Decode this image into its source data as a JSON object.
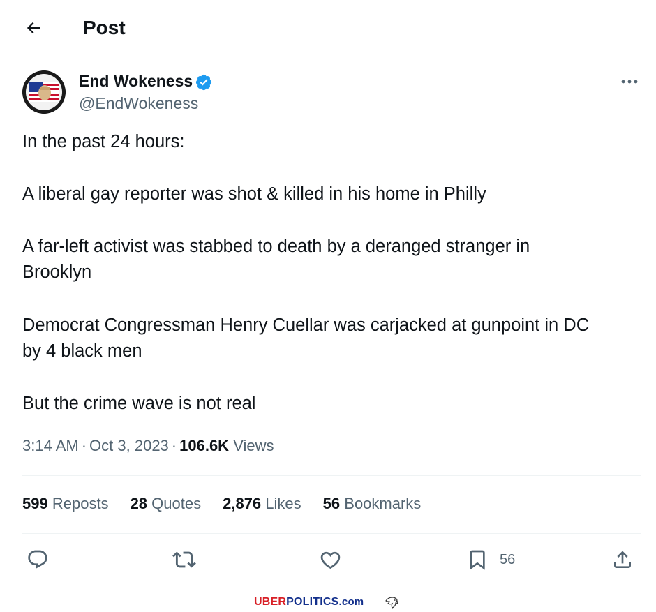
{
  "header": {
    "title": "Post",
    "back_icon": "arrow-left-icon"
  },
  "author": {
    "name": "End Wokeness",
    "handle": "@EndWokeness",
    "verified": true,
    "verified_color": "#1d9bf0"
  },
  "tweet": {
    "lines": [
      "In the past 24 hours:",
      "A liberal gay reporter was shot & killed in his home in Philly",
      "A far-left activist was stabbed to death by a deranged stranger in",
      "Brooklyn",
      "Democrat Congressman Henry Cuellar was carjacked at gunpoint in DC",
      "by 4 black men",
      "But the crime wave is not real"
    ]
  },
  "meta": {
    "time": "3:14 AM",
    "separator": "·",
    "date": "Oct 3, 2023",
    "views_count": "106.6K",
    "views_label": "Views"
  },
  "stats": {
    "reposts": {
      "count": "599",
      "label": "Reposts"
    },
    "quotes": {
      "count": "28",
      "label": "Quotes"
    },
    "likes": {
      "count": "2,876",
      "label": "Likes"
    },
    "bookmarks": {
      "count": "56",
      "label": "Bookmarks"
    }
  },
  "actions": {
    "bookmark_count": "56",
    "icons": [
      "reply-icon",
      "repost-icon",
      "like-icon",
      "bookmark-icon",
      "share-icon"
    ]
  },
  "footer": {
    "brand_part1": "UBER",
    "brand_part2": "POLITICS",
    "brand_part3": ".com"
  },
  "colors": {
    "text": "#0f1419",
    "secondary": "#536471",
    "accent": "#1d9bf0",
    "brand_red": "#d81f26",
    "brand_blue": "#13308c"
  }
}
